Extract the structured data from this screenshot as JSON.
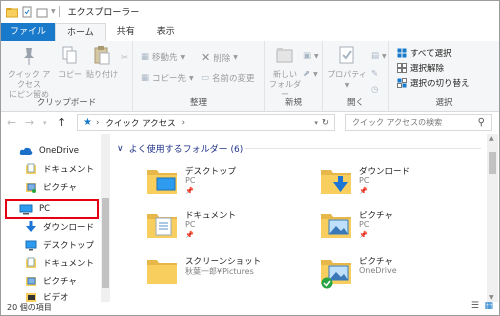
{
  "titlebar": {
    "title": "エクスプローラー",
    "separator": "|"
  },
  "tabs": [
    "ファイル",
    "ホーム",
    "共有",
    "表示"
  ],
  "ribbon": {
    "clipboard": {
      "pin_label_1": "クイック アクセス",
      "pin_label_2": "にピン留め",
      "copy": "コピー",
      "paste": "貼り付け",
      "group": "クリップボード"
    },
    "organize": {
      "move_to": "移動先",
      "copy_to": "コピー先",
      "delete": "削除",
      "rename": "名前の変更",
      "group": "整理"
    },
    "new": {
      "new_folder_1": "新しい",
      "new_folder_2": "フォルダー",
      "group": "新規"
    },
    "open": {
      "properties": "プロパティ",
      "group": "開く"
    },
    "select": {
      "select_all": "すべて選択",
      "select_none": "選択解除",
      "invert": "選択の切り替え",
      "group": "選択"
    }
  },
  "address": {
    "path": "クイック アクセス",
    "separator": "›",
    "search_placeholder": "クイック アクセスの検索"
  },
  "nav": {
    "items": [
      "OneDrive",
      "ドキュメント",
      "ピクチャ",
      "PC",
      "ダウンロード",
      "デスクトップ",
      "ドキュメント",
      "ピクチャ",
      "ビデオ"
    ]
  },
  "content": {
    "section_title": "よく使用するフォルダー (6)",
    "tiles": [
      {
        "name": "デスクトップ",
        "sub": "PC",
        "pin": "📌"
      },
      {
        "name": "ダウンロード",
        "sub": "PC",
        "pin": "📌"
      },
      {
        "name": "ドキュメント",
        "sub": "PC",
        "pin": "📌"
      },
      {
        "name": "ピクチャ",
        "sub": "PC",
        "pin": "📌"
      },
      {
        "name": "スクリーンショット",
        "sub": "秋葉一郎¥Pictures",
        "pin": ""
      },
      {
        "name": "ピクチャ",
        "sub": "OneDrive",
        "pin": ""
      }
    ]
  },
  "status": {
    "count": "20 個の項目"
  },
  "colors": {
    "accent": "#1979ca",
    "highlight": "#e60012",
    "folder": "#f8cf5f"
  }
}
